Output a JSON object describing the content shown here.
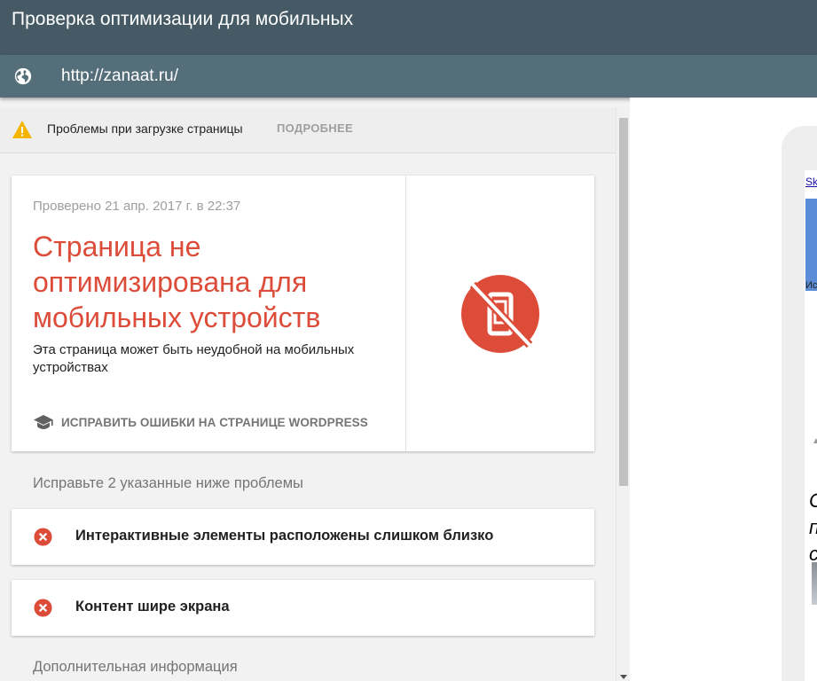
{
  "header": {
    "title": "Проверка оптимизации для мобильных",
    "url": "http://zanaat.ru/"
  },
  "warning": {
    "text": "Проблемы при загрузке страницы",
    "more_label": "ПОДРОБНЕЕ"
  },
  "result": {
    "checked": "Проверено 21 апр. 2017 г. в 22:37",
    "title": "Страница не оптимизирована для мобильных устройств",
    "description": "Эта страница может быть неудобной на мобильных устройствах",
    "fix_label": "ИСПРАВИТЬ ОШИБКИ НА СТРАНИЦЕ WORDPRESS"
  },
  "issues": {
    "heading": "Исправьте 2 указанные ниже проблемы",
    "items": [
      {
        "label": "Интерактивные элементы расположены слишком близко"
      },
      {
        "label": "Контент шире экрана"
      }
    ]
  },
  "extra": {
    "heading": "Дополнительная информация"
  },
  "preview": {
    "skip_text": "Sk",
    "banner_text": "Ис",
    "italic_lines": [
      "С",
      "п",
      "с"
    ]
  },
  "colors": {
    "app_bar": "#455a64",
    "url_bar": "#546e7a",
    "error_red": "#dd4b39",
    "warning_yellow": "#f4b400"
  },
  "icons": {
    "globe": "globe-icon",
    "warning": "warning-icon",
    "graduation_cap": "graduation-cap-icon",
    "not_mobile_friendly": "no-mobile-icon",
    "error": "error-icon"
  }
}
